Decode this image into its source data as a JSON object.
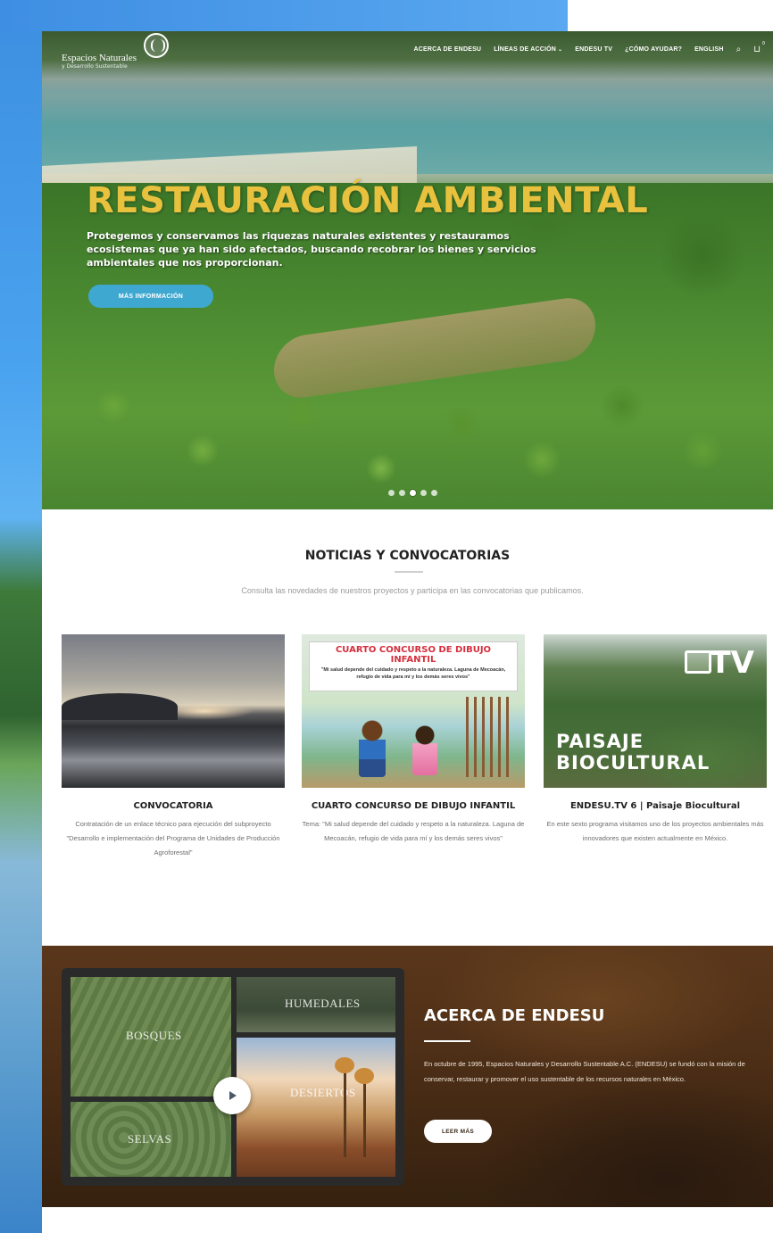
{
  "nav": {
    "logo_text": "Espacios Naturales",
    "logo_sub": "y Desarrollo Sustentable",
    "items": [
      {
        "label": "ACERCA DE ENDESU",
        "has_dropdown": false
      },
      {
        "label": "LÍNEAS DE ACCIÓN",
        "has_dropdown": true
      },
      {
        "label": "ENDESU TV",
        "has_dropdown": false
      },
      {
        "label": "¿CÓMO AYUDAR?",
        "has_dropdown": false
      },
      {
        "label": "ENGLISH",
        "has_dropdown": false
      }
    ],
    "search_icon": "search-icon",
    "cart_icon": "cart-icon",
    "cart_count": "0"
  },
  "hero": {
    "title": "RESTAURACIÓN AMBIENTAL",
    "text": "Protegemos y conservamos las riquezas naturales existentes y restauramos ecosistemas que ya han sido afectados, buscando recobrar los bienes y servicios ambientales que nos proporcionan.",
    "button_label": "MÁS INFORMACIÓN",
    "slides_total": 5,
    "active_slide": 3,
    "title_color": "#e8c23e",
    "button_color": "#3fa8d0"
  },
  "news": {
    "title": "NOTICIAS Y CONVOCATORIAS",
    "subtitle": "Consulta las novedades de nuestros proyectos y participa en las convocatorias que publicamos.",
    "cards": [
      {
        "title": "CONVOCATORIA",
        "description": "Contratación de un enlace técnico para ejecución del subproyecto \"Desarrollo e implementación del Programa de Unidades de Producción Agroforestal\""
      },
      {
        "title": "CUARTO CONCURSO DE DIBUJO INFANTIL",
        "description": "Tema: \"Mi salud depende del cuidado y respeto a la naturaleza. Laguna de Mecoacán, refugio de vida para mí y los demás seres vivos\"",
        "image_banner_title": "CUARTO CONCURSO DE DIBUJO INFANTIL",
        "image_banner_text": "\"Mi salud depende del cuidado y respeto a la naturaleza. Laguna de Mecoacán, refugio de vida para mí y los demás seres vivos\""
      },
      {
        "title": "ENDESU.TV 6 | Paisaje Biocultural",
        "description": "En este sexto programa visitamos uno de los proyectos ambientales más innovadores que existen actualmente en México.",
        "image_logo": "TV",
        "image_overlay_line1": "PAISAJE",
        "image_overlay_line2": "BIOCULTURAL"
      }
    ]
  },
  "about": {
    "title": "ACERCA DE ENDESU",
    "text": "En octubre de 1995, Espacios Naturales y Desarrollo Sustentable A.C. (ENDESU) se fundó con la misión de conservar, restaurar y promover el uso sustentable de los recursos naturales en México.",
    "button_label": "LEER MÁS",
    "collage_labels": [
      "BOSQUES",
      "HUMEDALES",
      "DESIERTOS",
      "SELVAS"
    ],
    "play_icon": "play-icon"
  }
}
